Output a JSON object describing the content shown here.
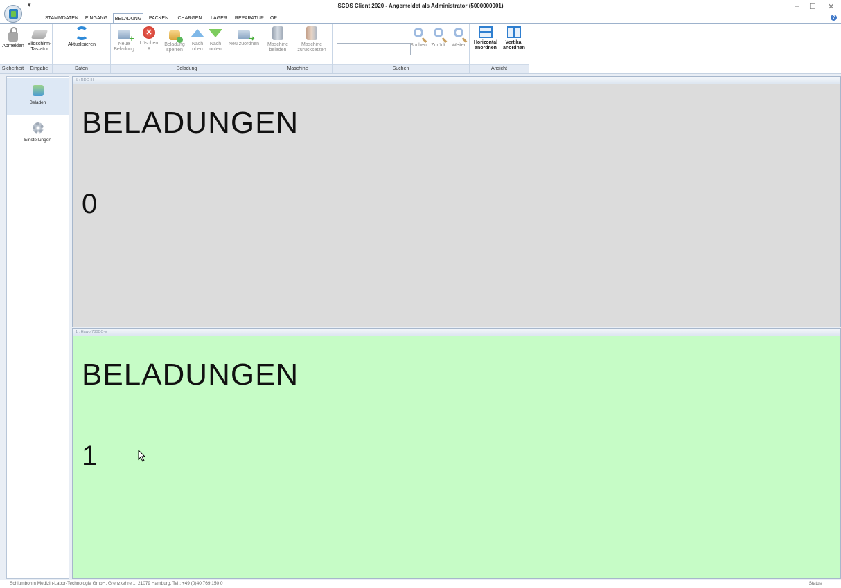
{
  "window": {
    "title": "SCDS Client 2020 - Angemeldet als Administrator (5000000001)",
    "qat_symbol": "▾",
    "minimize": "–",
    "maximize": "☐",
    "close": "✕"
  },
  "tabs": [
    {
      "label": "STAMMDATEN"
    },
    {
      "label": "EINGANG"
    },
    {
      "label": "BELADUNG",
      "active": true
    },
    {
      "label": "PACKEN"
    },
    {
      "label": "CHARGEN"
    },
    {
      "label": "LAGER"
    },
    {
      "label": "REPARATUR"
    },
    {
      "label": "OP"
    }
  ],
  "ribbon": {
    "groups": {
      "sicherheit": "Sicherheit",
      "eingabe": "Eingabe",
      "daten": "Daten",
      "beladung": "Beladung",
      "maschine": "Maschine",
      "suchen": "Suchen",
      "ansicht": "Ansicht"
    },
    "buttons": {
      "abmelden": "Abmelden",
      "bildschirm_tastatur": "Bildschirm-Tastatur",
      "aktualisieren": "Aktualisieren",
      "neue_beladung": "Neue Beladung",
      "loeschen": "Löschen",
      "loeschen_arrow": "▾",
      "beladung_sperren": "Beladung sperren",
      "nach_oben": "Nach oben",
      "nach_unten": "Nach unten",
      "neu_zuordnen": "Neu zuordnen",
      "maschine_beladen": "Maschine beladen",
      "maschine_zuruecksetzen": "Maschine zurücksetzen",
      "suchen": "Suchen",
      "zurueck": "Zurück",
      "weiter": "Weiter",
      "horizontal_anordnen": "Horizontal anordnen",
      "vertikal_anordnen": "Vertikal anordnen"
    },
    "search_value": ""
  },
  "nav": {
    "items": [
      {
        "label": "Beladen",
        "icon": "load-icon",
        "selected": true
      },
      {
        "label": "Einstellungen",
        "icon": "gear-icon",
        "selected": false
      }
    ]
  },
  "panels": [
    {
      "header": "5 : RDG III",
      "title": "BELADUNGEN",
      "count": "0",
      "bg": "#dcdcdc"
    },
    {
      "header": "1 : Hawo 780DC-V",
      "title": "BELADUNGEN",
      "count": "1",
      "bg": "#c6fcc6"
    }
  ],
  "status": {
    "company": "Schlumbohm Medizin-Labor-Technologie GmbH, Grenzkehre 1, 21079 Hamburg, Tel.: +49 (0)40 769 150 0",
    "right": "Status"
  }
}
